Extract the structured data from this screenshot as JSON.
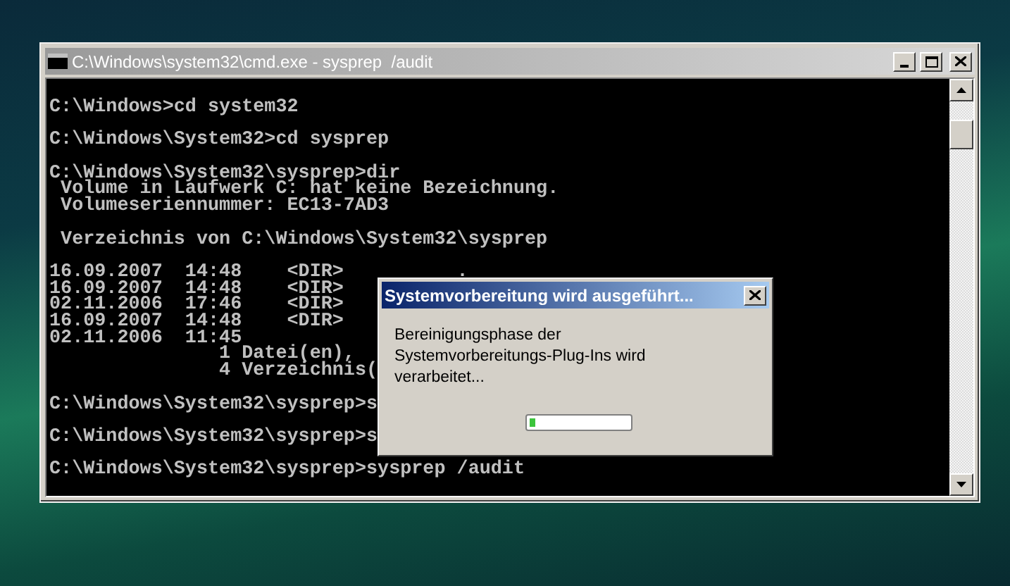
{
  "console_window": {
    "title": "C:\\Windows\\system32\\cmd.exe - sysprep  /audit",
    "active": false,
    "blocks": [
      [
        "C:\\Windows>cd system32"
      ],
      [
        "C:\\Windows\\System32>cd sysprep"
      ],
      [
        "C:\\Windows\\System32\\sysprep>dir",
        " Volume in Laufwerk C: hat keine Bezeichnung.",
        " Volumeseriennummer: EC13-7AD3"
      ],
      [
        " Verzeichnis von C:\\Windows\\System32\\sysprep"
      ],
      [
        "16.09.2007  14:48    <DIR>          .",
        "16.09.2007  14:48    <DIR>",
        "02.11.2006  17:46    <DIR>",
        "16.09.2007  14:48    <DIR>",
        "02.11.2006  11:45",
        "               1 Datei(en),",
        "               4 Verzeichnis("
      ],
      [
        "C:\\Windows\\System32\\sysprep>s"
      ],
      [
        "C:\\Windows\\System32\\sysprep>s"
      ],
      [
        "C:\\Windows\\System32\\sysprep>sysprep /audit"
      ]
    ]
  },
  "dialog": {
    "title": "Systemvorbereitung wird ausgeführt...",
    "message": "Bereinigungsphase der Systemvorbereitungs-Plug-Ins wird verarbeitet...",
    "progress": {
      "level": 0.06
    }
  }
}
